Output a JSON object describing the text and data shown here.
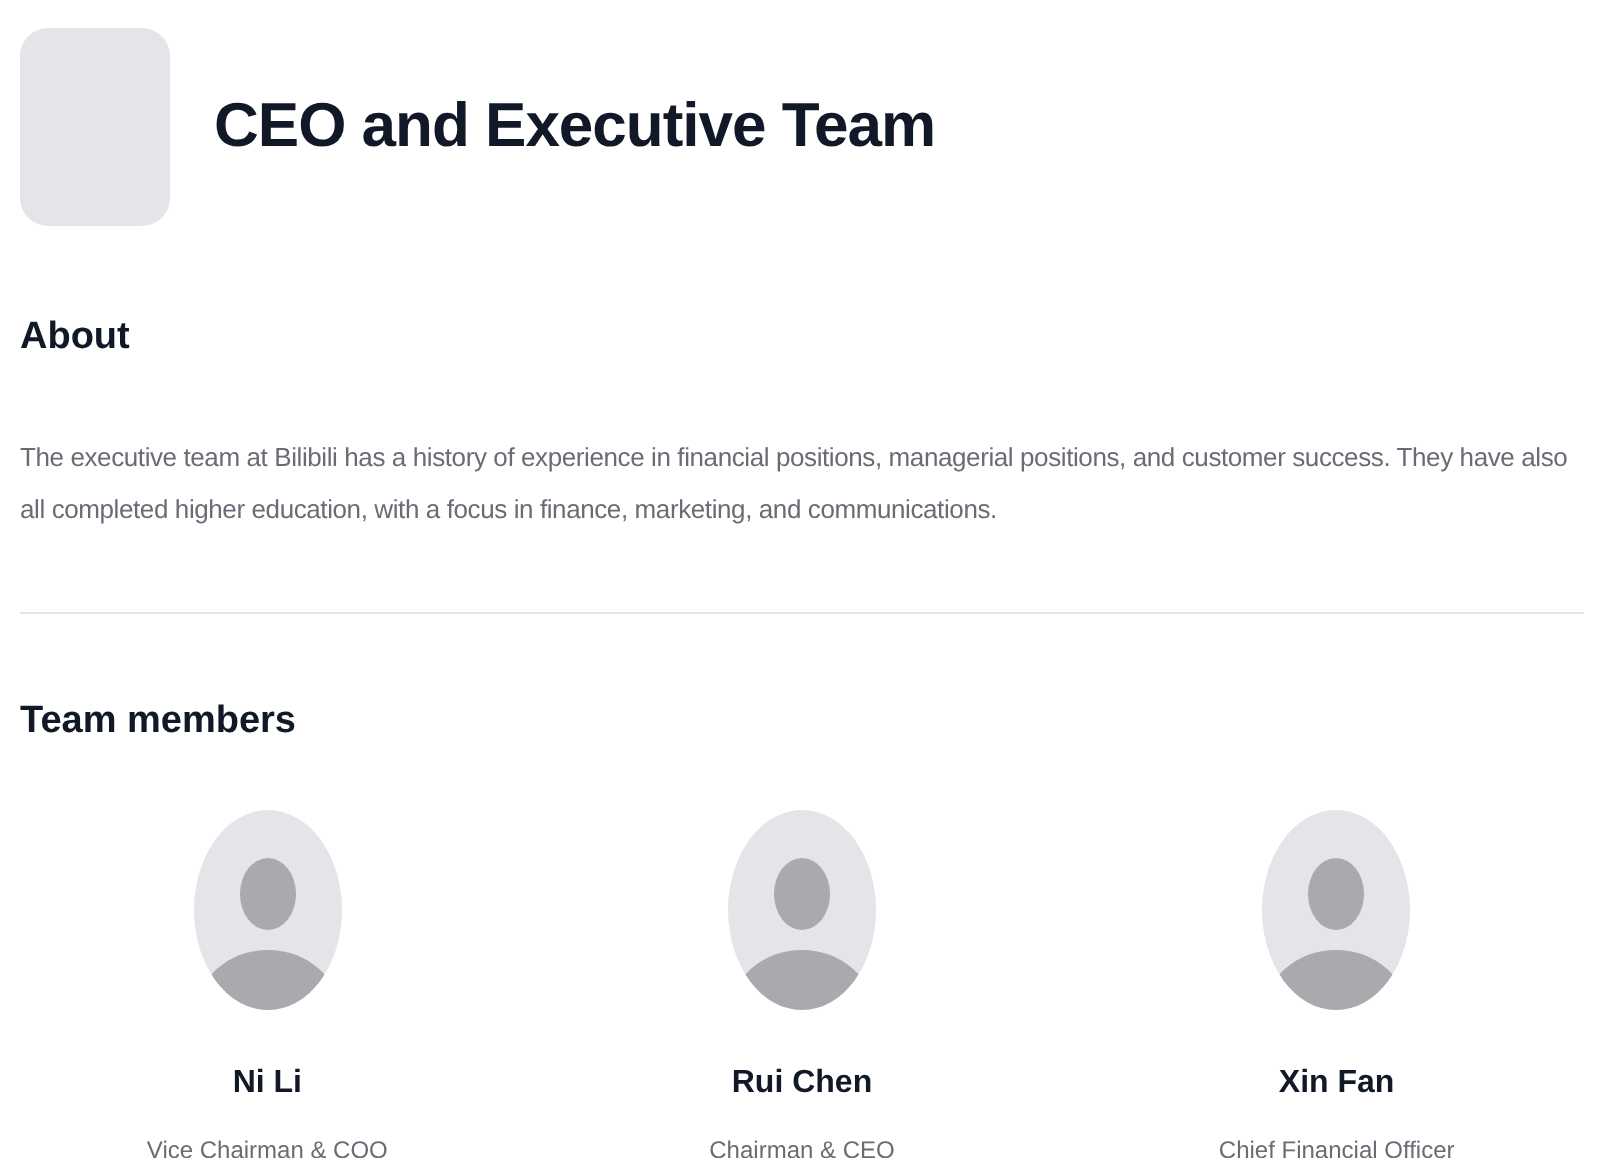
{
  "header": {
    "title": "CEO and Executive Team"
  },
  "about": {
    "heading": "About",
    "text": "The executive team at Bilibili has a history of experience in financial positions, managerial positions, and customer success. They have also all completed higher education, with a focus in finance, marketing, and communications."
  },
  "team": {
    "heading": "Team members",
    "members": [
      {
        "name": "Ni Li",
        "role": "Vice Chairman & COO"
      },
      {
        "name": "Rui Chen",
        "role": "Chairman & CEO"
      },
      {
        "name": "Xin Fan",
        "role": "Chief Financial Officer"
      }
    ]
  }
}
